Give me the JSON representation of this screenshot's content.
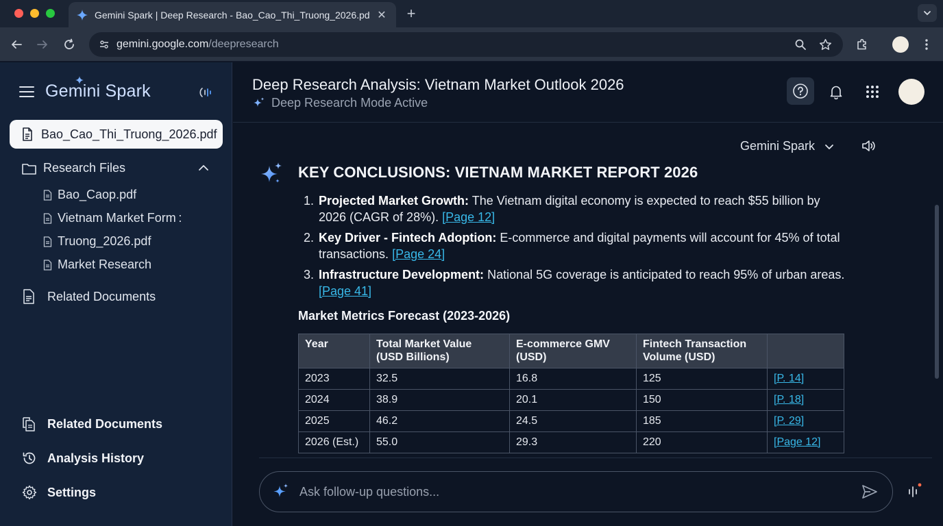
{
  "browser": {
    "tab_title": "Gemini Spark | Deep Research - Bao_Cao_Thi_Truong_2026.pdf",
    "tab_close": "✕",
    "new_tab": "+",
    "url_host": "gemini.google.com",
    "url_path": "/deepresearch"
  },
  "sidebar": {
    "brand": "Gemini Spark",
    "active_file": "Bao_Cao_Thi_Truong_2026.pdf",
    "research_files_label": "Research Files",
    "files": [
      "Bao_Caop.pdf",
      "Vietnam Market Form :",
      "Truong_2026.pdf",
      "Market Research"
    ],
    "related_documents_label": "Related Documents",
    "bottom": {
      "related_documents": "Related Documents",
      "analysis_history": "Analysis History",
      "settings": "Settings"
    }
  },
  "header": {
    "title": "Deep Research Analysis: Vietnam Market Outlook 2026",
    "mode": "Deep Research Mode Active"
  },
  "model_picker": {
    "label": "Gemini Spark"
  },
  "answer": {
    "heading": "KEY CONCLUSIONS: VIETNAM MARKET REPORT 2026",
    "points": [
      {
        "title": "Projected Market Growth:",
        "text": " The Vietnam digital economy is expected to reach $55 billion by 2026 (CAGR of 28%). ",
        "cite": "[Page 12]"
      },
      {
        "title": "Key Driver - Fintech Adoption:",
        "text": " E-commerce and digital payments will account for 45% of total transactions. ",
        "cite": "[Page 24]"
      },
      {
        "title": "Infrastructure Development:",
        "text": " National 5G coverage is anticipated to reach 95% of urban areas. ",
        "cite": "[Page 41]"
      }
    ],
    "metrics_title": "Market Metrics Forecast (2023-2026)"
  },
  "table": {
    "headers": [
      "Year",
      "Total Market Value\n(USD Billions)",
      "E-commerce GMV\n(USD)",
      "Fintech Transaction\nVolume (USD)",
      ""
    ],
    "rows": [
      [
        "2023",
        "32.5",
        "16.8",
        "125",
        "[P. 14]"
      ],
      [
        "2024",
        "38.9",
        "20.1",
        "150",
        "[P. 18]"
      ],
      [
        "2025",
        "46.2",
        "24.5",
        "185",
        "[P. 29]"
      ],
      [
        "2026 (Est.)",
        "55.0",
        "29.3",
        "220",
        "[Page 12]"
      ]
    ]
  },
  "composer": {
    "placeholder": "Ask follow-up questions..."
  },
  "colors": {
    "accent": "#38b8e8",
    "spark": "#5aa0ff",
    "background": "#0d1524",
    "sidebar": "#142238"
  }
}
